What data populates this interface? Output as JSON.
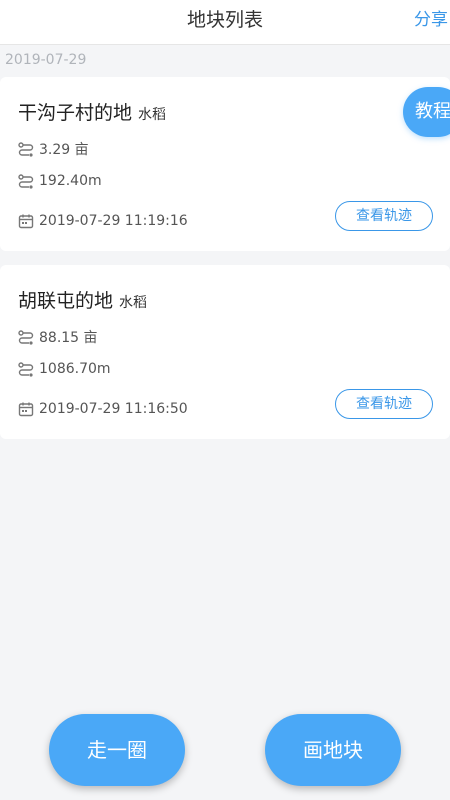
{
  "header": {
    "title": "地块列表",
    "share_label": "分享"
  },
  "list": {
    "date_group": "2019-07-29",
    "plots": [
      {
        "name": "干沟子村的地",
        "crop": "水稻",
        "area": "3.29 亩",
        "length": "192.40m",
        "time": "2019-07-29 11:19:16",
        "track_label": "查看轨迹"
      },
      {
        "name": "胡联屯的地",
        "crop": "水稻",
        "area": "88.15 亩",
        "length": "1086.70m",
        "time": "2019-07-29 11:16:50",
        "track_label": "查看轨迹"
      }
    ]
  },
  "tutorial_label": "教程",
  "actions": {
    "walk_label": "走一圈",
    "draw_label": "画地块"
  },
  "colors": {
    "accent": "#3a97e8",
    "button_fill": "#4aa8f7",
    "background": "#f4f5f7"
  },
  "icons": {
    "area": "route-icon",
    "length": "route-icon",
    "time": "calendar-icon"
  }
}
